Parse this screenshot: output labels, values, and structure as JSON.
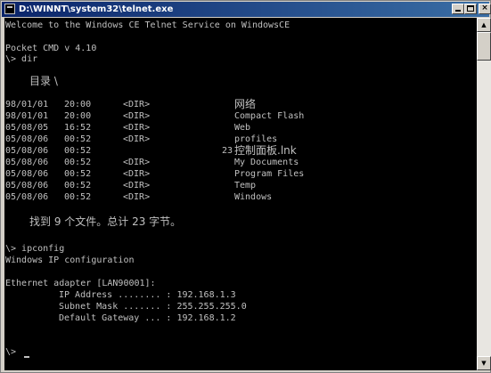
{
  "window": {
    "title": "D:\\WINNT\\system32\\telnet.exe"
  },
  "controls": {
    "minimize": "_",
    "maximize": "□",
    "close": "×"
  },
  "console": {
    "welcome": "Welcome to the Windows CE Telnet Service on WindowsCE",
    "version": "Pocket CMD v 4.10",
    "cmd_dir": "\\> dir",
    "dir_title": "目录 \\",
    "entries": [
      {
        "date": "98/01/01",
        "time": "20:00",
        "type": "<DIR>",
        "size": "",
        "name": "网络"
      },
      {
        "date": "98/01/01",
        "time": "20:00",
        "type": "<DIR>",
        "size": "",
        "name": "Compact Flash"
      },
      {
        "date": "05/08/05",
        "time": "16:52",
        "type": "<DIR>",
        "size": "",
        "name": "Web"
      },
      {
        "date": "05/08/06",
        "time": "00:52",
        "type": "<DIR>",
        "size": "",
        "name": "profiles"
      },
      {
        "date": "05/08/06",
        "time": "00:52",
        "type": "",
        "size": "23",
        "name": "控制面板.lnk"
      },
      {
        "date": "05/08/06",
        "time": "00:52",
        "type": "<DIR>",
        "size": "",
        "name": "My Documents"
      },
      {
        "date": "05/08/06",
        "time": "00:52",
        "type": "<DIR>",
        "size": "",
        "name": "Program Files"
      },
      {
        "date": "05/08/06",
        "time": "00:52",
        "type": "<DIR>",
        "size": "",
        "name": "Temp"
      },
      {
        "date": "05/08/06",
        "time": "00:52",
        "type": "<DIR>",
        "size": "",
        "name": "Windows"
      }
    ],
    "summary": "找到 9 个文件。总计 23 字节。",
    "cmd_ipconfig": "\\> ipconfig",
    "ip_header": "Windows IP configuration",
    "adapter": "Ethernet adapter [LAN90001]:",
    "ip_line": "IP Address ........ : 192.168.1.3",
    "mask_line": "Subnet Mask ....... : 255.255.255.0",
    "gateway_line": "Default Gateway ... : 192.168.1.2",
    "prompt": "\\>"
  },
  "scrollbar": {
    "up_icon": "▲",
    "down_icon": "▼"
  }
}
